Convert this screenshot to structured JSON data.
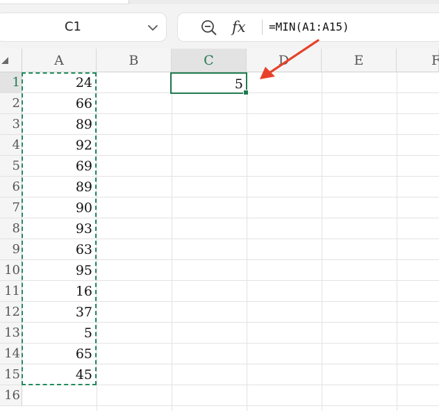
{
  "name_box": {
    "value": "C1"
  },
  "formula_bar": {
    "formula": "=MIN(A1:A15)",
    "fx_label": "fx"
  },
  "columns": [
    "A",
    "B",
    "C",
    "D",
    "E",
    "F"
  ],
  "active_column": "C",
  "rows": [
    "1",
    "2",
    "3",
    "4",
    "5",
    "6",
    "7",
    "8",
    "9",
    "10",
    "11",
    "12",
    "13",
    "14",
    "15",
    "16"
  ],
  "active_row": "1",
  "column_a_values": [
    "24",
    "66",
    "89",
    "92",
    "69",
    "89",
    "90",
    "93",
    "63",
    "95",
    "16",
    "37",
    "5",
    "65",
    "45"
  ],
  "active_cell": {
    "address": "C1",
    "value": "5"
  },
  "annotation": {
    "arrow_color": "#e8412b"
  },
  "colors": {
    "selection_green": "#1f7a4f",
    "marquee_green": "#1f8a5c"
  },
  "icons": [
    "chevron-down-icon",
    "zoom-icon",
    "fx-icon",
    "select-all-icon",
    "annotation-arrow-icon"
  ]
}
